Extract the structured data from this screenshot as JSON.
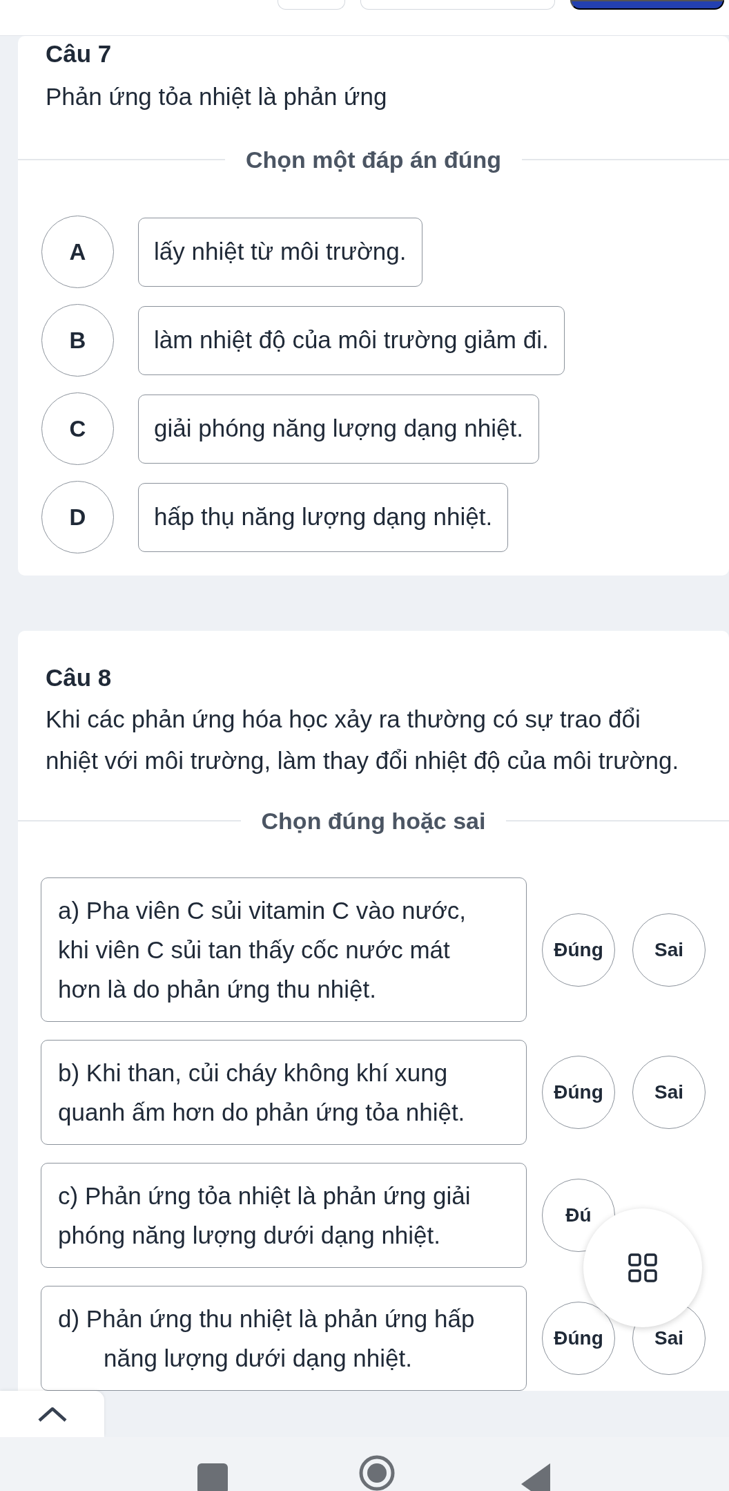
{
  "top_bar": {
    "buttons": [
      {
        "kind": "outline"
      },
      {
        "kind": "outline"
      },
      {
        "kind": "primary"
      }
    ]
  },
  "questions": [
    {
      "kind": "single_choice",
      "title": "Câu 7",
      "text": "Phản ứng tỏa nhiệt là phản ứng",
      "instruction": "Chọn một đáp án đúng",
      "options": [
        {
          "letter": "A",
          "text": "lấy nhiệt từ môi trường.",
          "selected": false
        },
        {
          "letter": "B",
          "text": "làm nhiệt độ của môi trường giảm đi.",
          "selected": false
        },
        {
          "letter": "C",
          "text": "giải phóng năng lượng dạng nhiệt.",
          "selected": false
        },
        {
          "letter": "D",
          "text": "hấp thụ năng lượng dạng nhiệt.",
          "selected": false
        }
      ]
    },
    {
      "kind": "true_false",
      "title": "Câu 8",
      "text": "Khi các phản ứng hóa học xảy ra thường có sự trao đổi nhiệt với môi trường, làm thay đổi nhiệt độ của môi trường.",
      "instruction": "Chọn đúng hoặc sai",
      "statements": [
        {
          "lines": [
            "a) Pha viên C sủi vitamin C vào nước,",
            "khi viên C sủi tan thấy cốc nước mát",
            "hơn là do phản ứng thu nhiệt."
          ],
          "overlapped": false,
          "buttons": [
            {
              "label": "Đúng",
              "selected": false
            },
            {
              "label": "Sai",
              "selected": false
            }
          ]
        },
        {
          "lines": [
            "b) Khi than, củi cháy không khí xung",
            "quanh ấm hơn do phản ứng tỏa nhiệt."
          ],
          "overlapped": false,
          "buttons": [
            {
              "label": "Đúng",
              "selected": false
            },
            {
              "label": "Sai",
              "selected": false
            }
          ]
        },
        {
          "lines": [
            "c) Phản ứng tỏa nhiệt là phản ứng giải",
            "phóng năng lượng dưới dạng nhiệt."
          ],
          "overlapped": false,
          "buttons": [
            {
              "label": "Đú",
              "selected": false
            }
          ]
        },
        {
          "lines": [
            "d) Phản ứng thu nhiệt là phản ứng hấp",
            "năng lượng dưới dạng nhiệt."
          ],
          "overlapped": true,
          "buttons": [
            {
              "label": "Đúng",
              "selected": false
            },
            {
              "label": "Sai",
              "selected": false
            }
          ]
        }
      ]
    }
  ],
  "floating_button": {
    "kind": "grid"
  },
  "scroll_top_button": {
    "kind": "caret_up"
  },
  "nav_bar": {
    "buttons": [
      {
        "kind": "recents"
      },
      {
        "kind": "home"
      },
      {
        "kind": "back"
      }
    ]
  }
}
